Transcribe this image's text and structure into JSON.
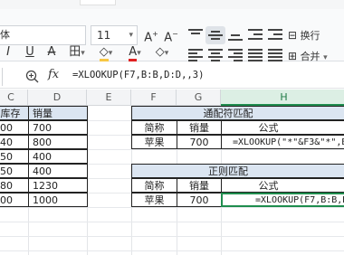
{
  "ribbon": {
    "font_name": "体",
    "font_size": "11",
    "grow_font": "A⁺",
    "shrink_font": "A⁻",
    "bold": "I",
    "underline": "U",
    "strike": "A",
    "border": "田",
    "fill": "◇",
    "font_color": "A",
    "clear": "◇",
    "wrap_text": "换行",
    "merge": "合并"
  },
  "formula_bar": {
    "fx_label": "fx",
    "formula": "=XLOOKUP(F7,B:B,D:D,,3)"
  },
  "columns": [
    "C",
    "D",
    "E",
    "F",
    "G",
    "H"
  ],
  "rows": [
    {
      "c": "库存",
      "d": "销量"
    },
    {
      "c": "00",
      "d": "700"
    },
    {
      "c": "40",
      "d": "800"
    },
    {
      "c": "50",
      "d": "400"
    },
    {
      "c": "50",
      "d": "400"
    },
    {
      "c": "80",
      "d": "1230"
    },
    {
      "c": "00",
      "d": "1000"
    }
  ],
  "wildcard_table": {
    "title": "通配符匹配",
    "headers": [
      "简称",
      "销量",
      "公式"
    ],
    "row": [
      "苹果",
      "700",
      "=XLOOKUP(\"*\"&F3&\"*\",B:"
    ]
  },
  "regex_table": {
    "title": "正则匹配",
    "headers": [
      "简称",
      "销量",
      "公式"
    ],
    "row": [
      "苹果",
      "700",
      "=XLOOKUP(F7,B:B,D:"
    ]
  }
}
